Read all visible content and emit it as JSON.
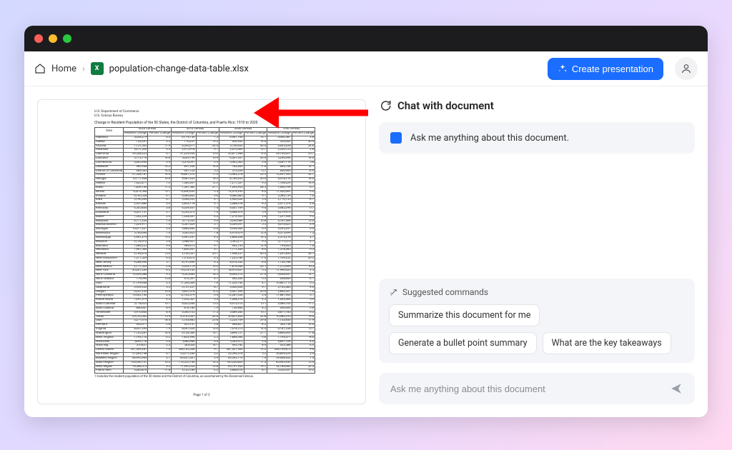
{
  "breadcrumb": {
    "home": "Home",
    "filename": "population-change-data-table.xlsx",
    "filetype_badge": "X"
  },
  "actions": {
    "create_presentation": "Create presentation"
  },
  "chat": {
    "header": "Chat with document",
    "intro": "Ask me anything about this document.",
    "suggested_label": "Suggested commands",
    "suggestions": [
      "Summarize this document for me",
      "Generate a bullet point summary",
      "What are the key takeaways"
    ],
    "input_placeholder": "Ask me anything about this document"
  },
  "document": {
    "dept_line1": "U.S. Department of Commerce",
    "dept_line2": "U.S. Census Bureau",
    "title": "Change in Resident Population of the 50 States, the District of Columbia, and Puerto Rico: 1910 to 2020",
    "group_headers": [
      "2020 Census",
      "2010 Census",
      "2000 Census",
      "1990 Census"
    ],
    "sub_headers": [
      "Resident Change",
      "Percent Change",
      "Resident Change",
      "Percent Change",
      "Resident Change",
      "Percent Change",
      "Resident Change",
      "Percent Change"
    ],
    "area_header": "Area",
    "rows": [
      [
        "Alabama",
        "5,024,279",
        "6.3",
        "4,779,736",
        "7.5",
        "4,447,100",
        "10.1",
        "4,040,587",
        "3.8"
      ],
      [
        "Alaska",
        "733,391",
        "3.3",
        "710,231",
        "13.3",
        "626,932",
        "14.0",
        "550,043",
        "36.9"
      ],
      [
        "Arizona",
        "7,151,502",
        "11.9",
        "6,392,017",
        "24.6",
        "5,130,632",
        "40.0",
        "3,665,228",
        "34.8"
      ],
      [
        "Arkansas",
        "3,011,524",
        "3.3",
        "2,915,918",
        "9.1",
        "2,673,400",
        "13.7",
        "2,350,725",
        "2.8"
      ],
      [
        "California",
        "39,538,223",
        "6.1",
        "37,253,956",
        "10.0",
        "33,871,648",
        "13.6",
        "29,760,021",
        "25.7"
      ],
      [
        "Colorado",
        "5,773,714",
        "14.8",
        "5,029,196",
        "16.9",
        "4,301,261",
        "30.6",
        "3,294,394",
        "14.0"
      ],
      [
        "Connecticut",
        "3,605,944",
        "0.9",
        "3,574,097",
        "4.9",
        "3,405,565",
        "3.6",
        "3,287,116",
        "5.8"
      ],
      [
        "Delaware",
        "989,948",
        "10.2",
        "897,934",
        "14.6",
        "783,600",
        "17.6",
        "666,168",
        "12.1"
      ],
      [
        "District of Columbia",
        "689,545",
        "14.6",
        "601,723",
        "5.2",
        "572,059",
        "-5.7",
        "606,900",
        "-4.9"
      ],
      [
        "Florida",
        "21,538,187",
        "14.6",
        "18,801,310",
        "17.6",
        "15,982,378",
        "23.5",
        "12,937,926",
        "32.7"
      ],
      [
        "Georgia",
        "10,711,908",
        "10.6",
        "9,687,653",
        "18.3",
        "8,186,453",
        "26.4",
        "6,478,216",
        "18.6"
      ],
      [
        "Hawaii",
        "1,455,271",
        "7.0",
        "1,360,301",
        "12.3",
        "1,211,537",
        "9.3",
        "1,108,229",
        "14.9"
      ],
      [
        "Idaho",
        "1,839,106",
        "17.3",
        "1,567,582",
        "21.1",
        "1,293,953",
        "28.5",
        "1,006,749",
        "6.7"
      ],
      [
        "Illinois",
        "12,812,508",
        "-0.1",
        "12,830,632",
        "3.3",
        "12,419,293",
        "8.6",
        "11,430,602",
        "0.0"
      ],
      [
        "Indiana",
        "6,785,528",
        "4.7",
        "6,483,802",
        "6.6",
        "6,080,485",
        "9.7",
        "5,544,159",
        "1.0"
      ],
      [
        "Iowa",
        "3,190,369",
        "4.7",
        "3,046,355",
        "4.1",
        "2,926,324",
        "5.4",
        "2,776,755",
        "-4.7"
      ],
      [
        "Kansas",
        "2,937,880",
        "3.0",
        "2,853,118",
        "6.1",
        "2,688,418",
        "8.5",
        "2,477,574",
        "4.8"
      ],
      [
        "Kentucky",
        "4,505,836",
        "3.8",
        "4,339,367",
        "7.4",
        "4,041,769",
        "9.6",
        "3,685,296",
        "0.7"
      ],
      [
        "Louisiana",
        "4,657,757",
        "2.7",
        "4,533,372",
        "1.4",
        "4,468,976",
        "5.9",
        "4,219,973",
        "0.3"
      ],
      [
        "Maine",
        "1,362,359",
        "2.6",
        "1,328,361",
        "4.2",
        "1,274,923",
        "3.8",
        "1,227,928",
        "9.2"
      ],
      [
        "Maryland",
        "6,177,224",
        "7.0",
        "5,773,552",
        "9.0",
        "5,296,486",
        "10.8",
        "4,781,468",
        "13.4"
      ],
      [
        "Massachusetts",
        "7,029,917",
        "7.4",
        "6,547,629",
        "3.1",
        "6,349,097",
        "5.5",
        "6,016,425",
        "4.9"
      ],
      [
        "Michigan",
        "10,077,331",
        "2.0",
        "9,883,640",
        "-0.6",
        "9,938,444",
        "6.9",
        "9,295,297",
        "0.4"
      ],
      [
        "Minnesota",
        "5,706,494",
        "7.6",
        "5,303,925",
        "7.8",
        "4,919,479",
        "12.4",
        "4,375,099",
        "7.3"
      ],
      [
        "Mississippi",
        "2,961,279",
        "-0.2",
        "2,967,297",
        "4.3",
        "2,844,658",
        "10.5",
        "2,573,216",
        "2.1"
      ],
      [
        "Missouri",
        "6,154,913",
        "2.8",
        "5,988,927",
        "7.0",
        "5,595,211",
        "9.3",
        "5,117,073",
        "4.1"
      ],
      [
        "Montana",
        "1,084,225",
        "9.6",
        "989,415",
        "9.7",
        "902,195",
        "12.9",
        "799,065",
        "1.6"
      ],
      [
        "Nebraska",
        "1,961,504",
        "7.4",
        "1,826,341",
        "6.7",
        "1,711,263",
        "8.4",
        "1,578,385",
        "0.5"
      ],
      [
        "Nevada",
        "3,104,614",
        "15.0",
        "2,700,551",
        "35.1",
        "1,998,257",
        "66.3",
        "1,201,833",
        "50.1"
      ],
      [
        "New Hampshire",
        "1,377,529",
        "4.6",
        "1,316,470",
        "6.5",
        "1,235,786",
        "11.4",
        "1,109,252",
        "20.5"
      ],
      [
        "New Jersey",
        "9,288,994",
        "5.7",
        "8,791,894",
        "4.5",
        "8,414,350",
        "8.6",
        "7,730,188",
        "5.0"
      ],
      [
        "New Mexico",
        "2,117,522",
        "2.8",
        "2,059,179",
        "13.2",
        "1,819,046",
        "20.1",
        "1,515,069",
        "16.3"
      ],
      [
        "New York",
        "20,201,249",
        "4.2",
        "19,378,102",
        "2.1",
        "18,976,457",
        "5.5",
        "17,990,455",
        "2.5"
      ],
      [
        "North Carolina",
        "10,439,388",
        "9.5",
        "9,535,483",
        "18.5",
        "8,049,313",
        "21.4",
        "6,628,637",
        "12.7"
      ],
      [
        "North Dakota",
        "779,094",
        "15.8",
        "672,591",
        "4.7",
        "642,200",
        "0.5",
        "638,800",
        "-2.1"
      ],
      [
        "Ohio",
        "11,799,448",
        "2.3",
        "11,536,504",
        "1.6",
        "11,353,140",
        "4.7",
        "10,847,115",
        "0.5"
      ],
      [
        "Oklahoma",
        "3,959,353",
        "5.5",
        "3,751,351",
        "8.7",
        "3,450,654",
        "9.7",
        "3,145,585",
        "4.0"
      ],
      [
        "Oregon",
        "4,237,256",
        "10.6",
        "3,831,074",
        "12.0",
        "3,421,399",
        "20.4",
        "2,842,321",
        "7.9"
      ],
      [
        "Pennsylvania",
        "13,002,700",
        "2.4",
        "12,702,379",
        "3.4",
        "12,281,054",
        "3.4",
        "11,881,643",
        "0.1"
      ],
      [
        "Rhode Island",
        "1,097,379",
        "4.3",
        "1,052,567",
        "0.4",
        "1,048,319",
        "4.5",
        "1,003,464",
        "5.9"
      ],
      [
        "South Carolina",
        "5,118,425",
        "10.7",
        "4,625,364",
        "15.3",
        "4,012,012",
        "15.1",
        "3,486,703",
        "11.7"
      ],
      [
        "South Dakota",
        "886,667",
        "8.9",
        "814,180",
        "7.9",
        "754,844",
        "8.5",
        "696,004",
        "0.8"
      ],
      [
        "Tennessee",
        "6,910,840",
        "8.9",
        "6,346,105",
        "11.5",
        "5,689,283",
        "16.7",
        "4,877,185",
        "6.2"
      ],
      [
        "Texas",
        "29,145,505",
        "15.9",
        "25,145,561",
        "20.6",
        "20,851,820",
        "22.8",
        "16,986,510",
        "19.4"
      ],
      [
        "Utah",
        "3,271,616",
        "18.4",
        "2,763,885",
        "23.8",
        "2,233,169",
        "29.6",
        "1,722,850",
        "17.9"
      ],
      [
        "Vermont",
        "643,077",
        "2.8",
        "625,741",
        "2.8",
        "608,827",
        "8.2",
        "562,758",
        "10.0"
      ],
      [
        "Virginia",
        "8,631,393",
        "7.9",
        "8,001,024",
        "13.0",
        "7,078,515",
        "14.4",
        "6,187,358",
        "15.7"
      ],
      [
        "Washington",
        "7,705,281",
        "14.6",
        "6,724,540",
        "14.1",
        "5,894,121",
        "21.1",
        "4,866,692",
        "17.8"
      ],
      [
        "West Virginia",
        "1,793,716",
        "-3.2",
        "1,852,994",
        "2.5",
        "1,808,344",
        "0.8",
        "1,793,477",
        "-8.0"
      ],
      [
        "Wisconsin",
        "5,893,718",
        "3.6",
        "5,686,986",
        "6.0",
        "5,363,675",
        "9.6",
        "4,891,769",
        "4.0"
      ],
      [
        "Wyoming",
        "576,851",
        "2.3",
        "563,626",
        "14.1",
        "493,782",
        "8.9",
        "453,588",
        "-3.4"
      ],
      [
        "United States",
        "331,449,281",
        "7.4",
        "308,745,538",
        "9.7",
        "281,421,906",
        "13.2",
        "248,709,873",
        "9.8"
      ],
      [
        "Northeast Region",
        "57,609,148",
        "4.1",
        "55,317,240",
        "3.2",
        "53,594,378",
        "5.5",
        "50,809,229",
        "3.4"
      ],
      [
        "Midwest Region",
        "68,995,949",
        "3.1",
        "66,927,001",
        "3.9",
        "64,392,776",
        "7.9",
        "59,668,632",
        "1.4"
      ],
      [
        "South Region",
        "126,266,107",
        "10.2",
        "114,555,744",
        "14.3",
        "100,236,820",
        "17.3",
        "85,445,930",
        "13.4"
      ],
      [
        "West Region",
        "78,588,572",
        "9.2",
        "71,945,553",
        "13.8",
        "63,197,932",
        "19.7",
        "52,786,082",
        "22.3"
      ],
      [
        "Puerto Rico",
        "3,285,874",
        "-11.8",
        "3,725,789",
        "-2.2",
        "3,808,610",
        "8.1",
        "3,522,037",
        "10.2"
      ]
    ],
    "footnote": "1 Includes the resident population of the 50 states and the District of Columbia, as ascertained by the Decennial Census.",
    "pagenum": "Page 1 of 3"
  }
}
